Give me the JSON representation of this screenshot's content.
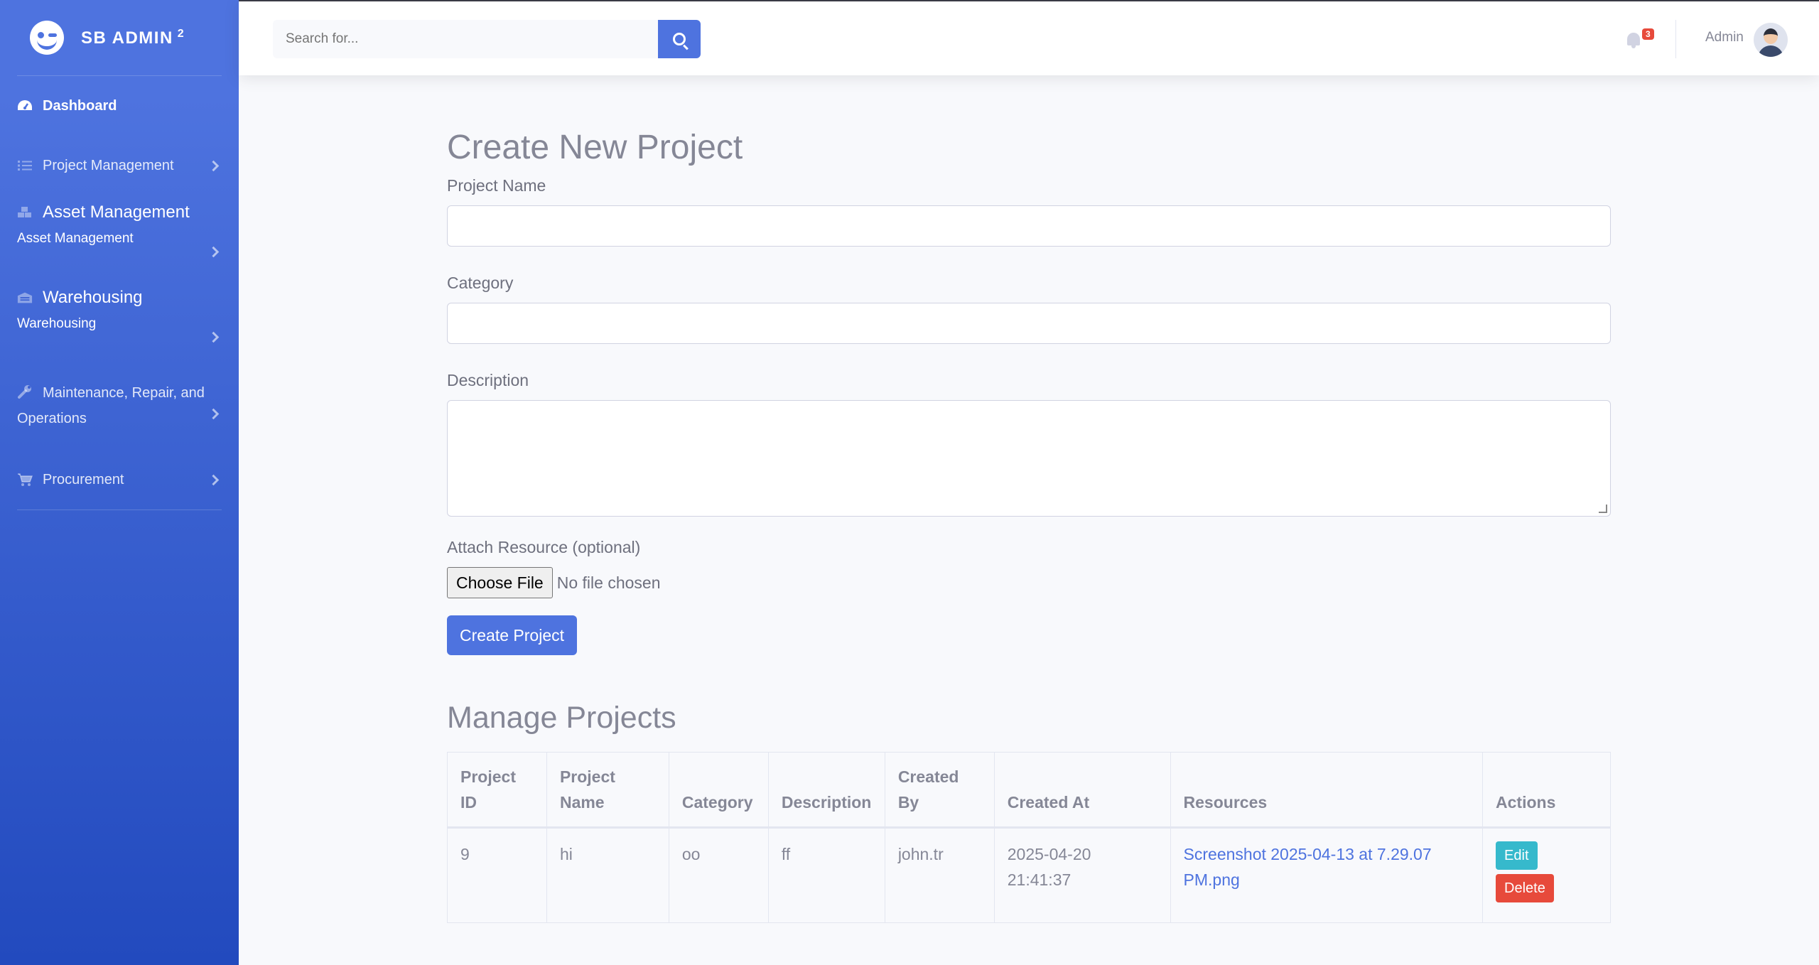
{
  "sidebar": {
    "brand": {
      "text": "SB ADMIN",
      "sup": "2"
    },
    "dashboard": "Dashboard",
    "project_management": "Project Management",
    "asset_management": {
      "title": "Asset Management",
      "sub": "Asset Management"
    },
    "warehousing": {
      "title": "Warehousing",
      "sub": "Warehousing"
    },
    "mro": "Maintenance, Repair, and Operations",
    "procurement": "Procurement"
  },
  "topbar": {
    "search_placeholder": "Search for...",
    "alerts_count": "3",
    "user_name": "Admin"
  },
  "create_form": {
    "heading": "Create New Project",
    "project_name_label": "Project Name",
    "category_label": "Category",
    "description_label": "Description",
    "attach_label": "Attach Resource (optional)",
    "file_button": "Choose File",
    "file_status": "No file chosen",
    "submit_label": "Create Project"
  },
  "manage": {
    "heading": "Manage Projects",
    "columns": [
      "Project ID",
      "Project Name",
      "Category",
      "Description",
      "Created By",
      "Created At",
      "Resources",
      "Actions"
    ],
    "rows": [
      {
        "id": "9",
        "name": "hi",
        "category": "oo",
        "description": "ff",
        "created_by": "john.tr",
        "created_at": "2025-04-20 21:41:37",
        "resource": "Screenshot 2025-04-13 at 7.29.07 PM.png",
        "edit_label": "Edit",
        "delete_label": "Delete"
      }
    ]
  },
  "colors": {
    "primary": "#4e73df",
    "info": "#36b9cc",
    "danger": "#e74a3b",
    "text": "#858796"
  }
}
